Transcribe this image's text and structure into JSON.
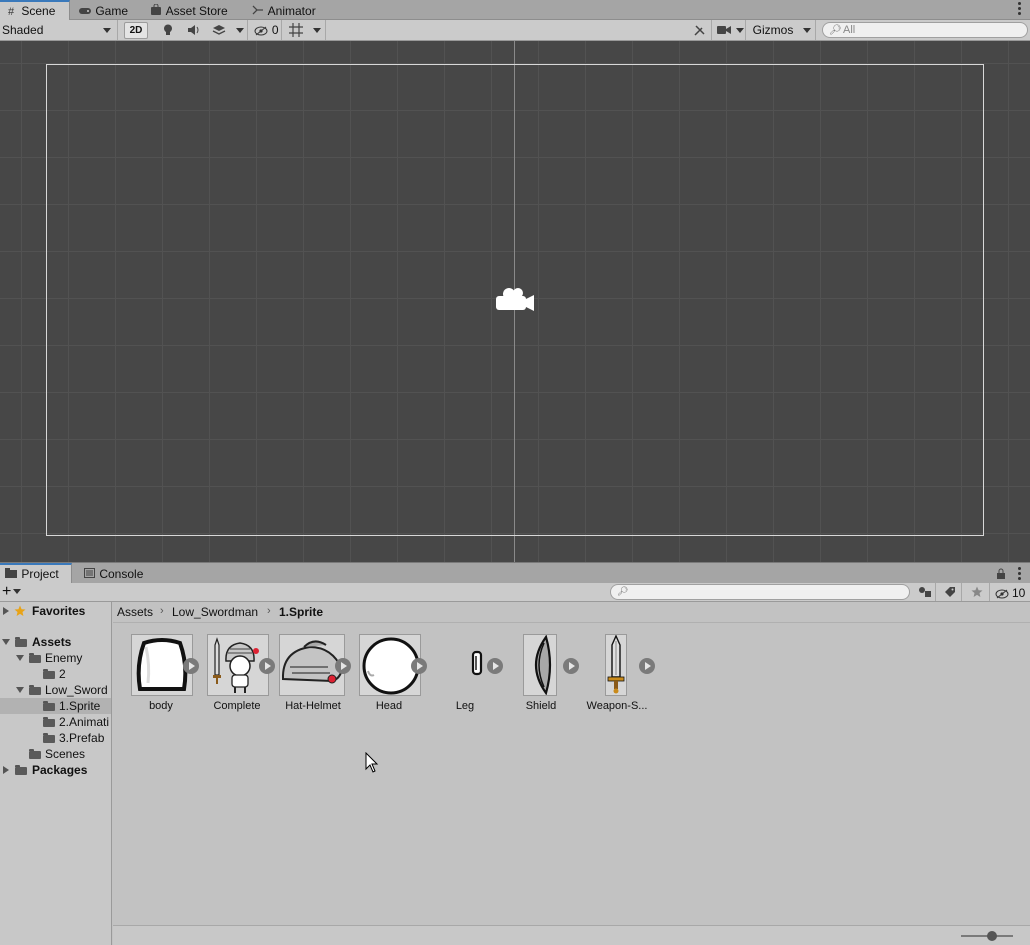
{
  "scene_tabs": [
    {
      "label": "Scene",
      "icon": "hash-grid-icon",
      "active": true
    },
    {
      "label": "Game",
      "icon": "gamepad-icon",
      "active": false
    },
    {
      "label": "Asset Store",
      "icon": "shopping-bag-icon",
      "active": false
    },
    {
      "label": "Animator",
      "icon": "animator-icon",
      "active": false
    }
  ],
  "scene_toolbar": {
    "draw_mode": "Shaded",
    "mode_2d": "2D",
    "hidden_count": "0",
    "gizmos_label": "Gizmos",
    "search_placeholder": "All"
  },
  "project_tabs": [
    {
      "label": "Project",
      "icon": "folder-icon",
      "active": true
    },
    {
      "label": "Console",
      "icon": "console-icon",
      "active": false
    }
  ],
  "project_toolbar": {
    "hidden_count": "10"
  },
  "tree": {
    "favorites": "Favorites",
    "assets": "Assets",
    "enemy": "Enemy",
    "enemy_child": "2",
    "low_sword": "Low_Sword",
    "sprite_folder": "1.Sprite",
    "anim_folder": "2.Animati",
    "prefab_folder": "3.Prefab",
    "scenes": "Scenes",
    "packages": "Packages"
  },
  "breadcrumb": [
    "Assets",
    "Low_Swordman",
    "1.Sprite"
  ],
  "assets": [
    {
      "label": "body",
      "icon": "body-sprite-icon"
    },
    {
      "label": "Complete",
      "icon": "knight-sprite-icon"
    },
    {
      "label": "Hat-Helmet",
      "icon": "helmet-sprite-icon"
    },
    {
      "label": "Head",
      "icon": "head-sprite-icon"
    },
    {
      "label": "Leg",
      "icon": "leg-sprite-icon"
    },
    {
      "label": "Shield",
      "icon": "shield-sprite-icon"
    },
    {
      "label": "Weapon-S...",
      "icon": "sword-sprite-icon"
    }
  ],
  "colors": {
    "accent": "#3a79bb",
    "scene_bg": "#474747",
    "panel_bg": "#c2c2c2"
  }
}
